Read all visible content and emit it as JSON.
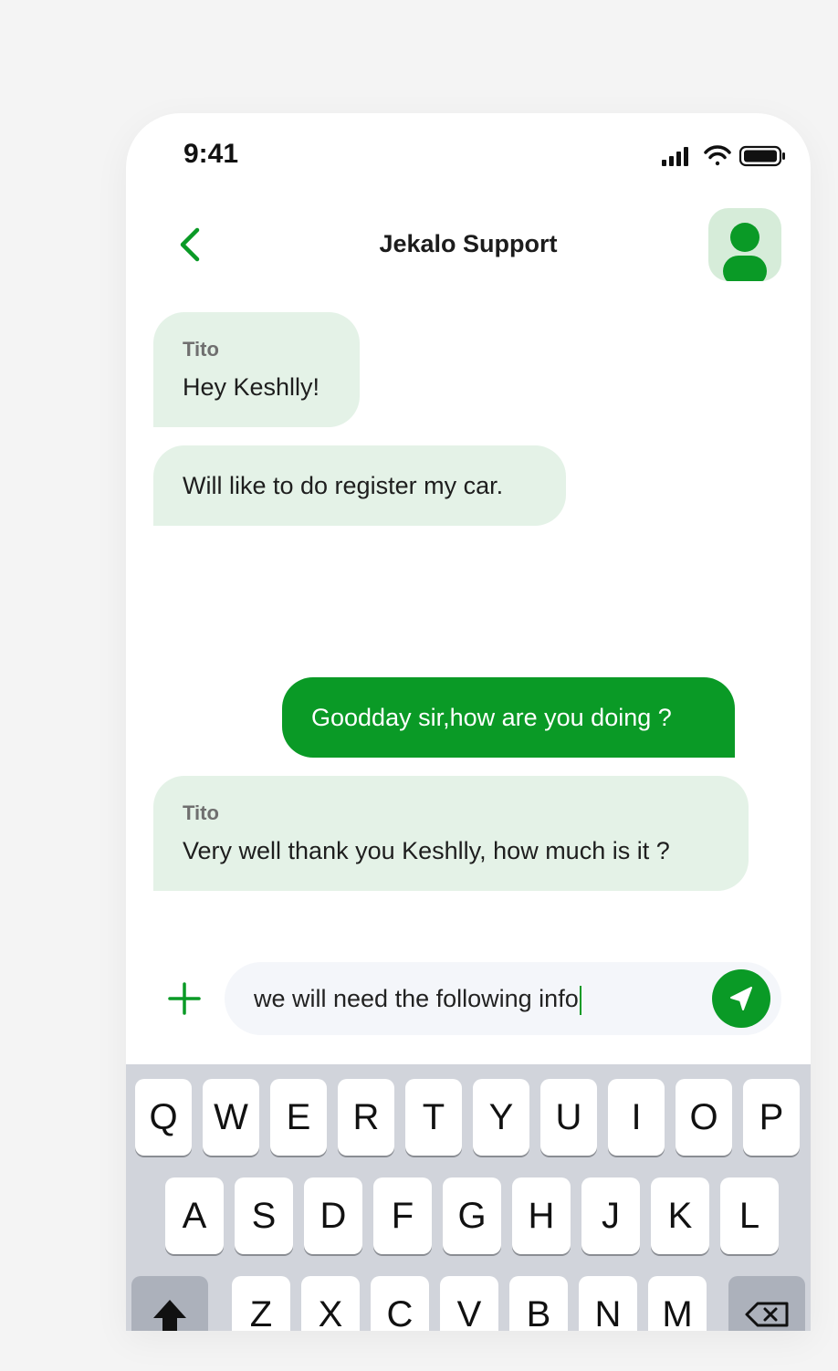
{
  "status_bar": {
    "time": "9:41",
    "icons": [
      "cellular-signal-icon",
      "wifi-icon",
      "battery-icon"
    ]
  },
  "header": {
    "title": "Jekalo Support",
    "back_icon": "chevron-left-icon",
    "avatar_icon": "user-icon"
  },
  "messages": [
    {
      "sender": "Tito",
      "text": "Hey Keshlly!",
      "direction": "incoming"
    },
    {
      "sender": "",
      "text": "Will like to do register my car.",
      "direction": "incoming"
    },
    {
      "sender": "",
      "text": "Goodday sir,how are you doing ?",
      "direction": "outgoing"
    },
    {
      "sender": "Tito",
      "text": "Very well thank you Keshlly, how much is it ?",
      "direction": "incoming"
    }
  ],
  "composer": {
    "value": "we will need the following info",
    "attach_icon": "plus-icon",
    "send_icon": "send-icon"
  },
  "keyboard": {
    "row1": [
      "Q",
      "W",
      "E",
      "R",
      "T",
      "Y",
      "U",
      "I",
      "O",
      "P"
    ],
    "row2": [
      "A",
      "S",
      "D",
      "F",
      "G",
      "H",
      "J",
      "K",
      "L"
    ],
    "row3": [
      "Z",
      "X",
      "C",
      "V",
      "B",
      "N",
      "M"
    ],
    "shift_icon": "shift-icon",
    "delete_icon": "backspace-icon"
  },
  "colors": {
    "accent": "#0a9a26",
    "incoming_bubble": "#e4f2e7",
    "avatar_bg": "#d6ecd9",
    "keyboard_bg": "#d1d4db"
  }
}
